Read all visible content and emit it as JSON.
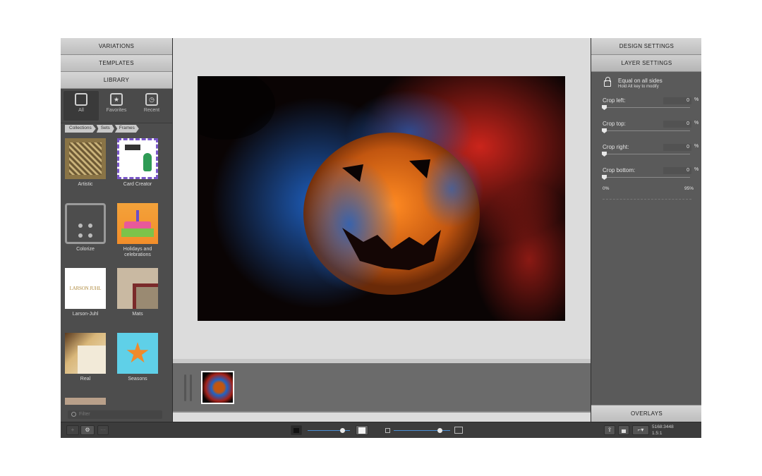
{
  "left_panel": {
    "tabs": [
      "VARIATIONS",
      "TEMPLATES",
      "LIBRARY"
    ],
    "filters": [
      {
        "label": "All",
        "icon": "all-square-icon"
      },
      {
        "label": "Favorites",
        "icon": "star-icon"
      },
      {
        "label": "Recent",
        "icon": "clock-icon"
      }
    ],
    "breadcrumb": [
      "Collections",
      "Sets",
      "Frames"
    ],
    "items": [
      {
        "label": "Artistic"
      },
      {
        "label": "Card Creator"
      },
      {
        "label": "Colorize"
      },
      {
        "label": "Holidays and celebrations"
      },
      {
        "label": "Larson-Juhl",
        "logo_text": "LARSON JUHL"
      },
      {
        "label": "Mats"
      },
      {
        "label": "Real"
      },
      {
        "label": "Seasons"
      }
    ],
    "filter_placeholder": "Filter"
  },
  "right_panel": {
    "tabs": [
      "DESIGN SETTINGS",
      "LAYER SETTINGS"
    ],
    "equal_sides_label": "Equal on all sides",
    "equal_sides_hint": "Hold Alt key to modify",
    "crops": [
      {
        "label": "Crop left:",
        "value": "0",
        "unit": "%"
      },
      {
        "label": "Crop top:",
        "value": "0",
        "unit": "%"
      },
      {
        "label": "Crop right:",
        "value": "0",
        "unit": "%"
      },
      {
        "label": "Crop bottom:",
        "value": "0",
        "unit": "%"
      }
    ],
    "range_min": "0%",
    "range_max": "95%",
    "overlays_label": "OVERLAYS"
  },
  "bottom_bar": {
    "add_label": "+",
    "gear_label": "⚙",
    "more_label": "···",
    "dimensions": "5168:3448",
    "ratio": "1.5:1"
  },
  "colors": {
    "accent": "#4a8fd4"
  }
}
